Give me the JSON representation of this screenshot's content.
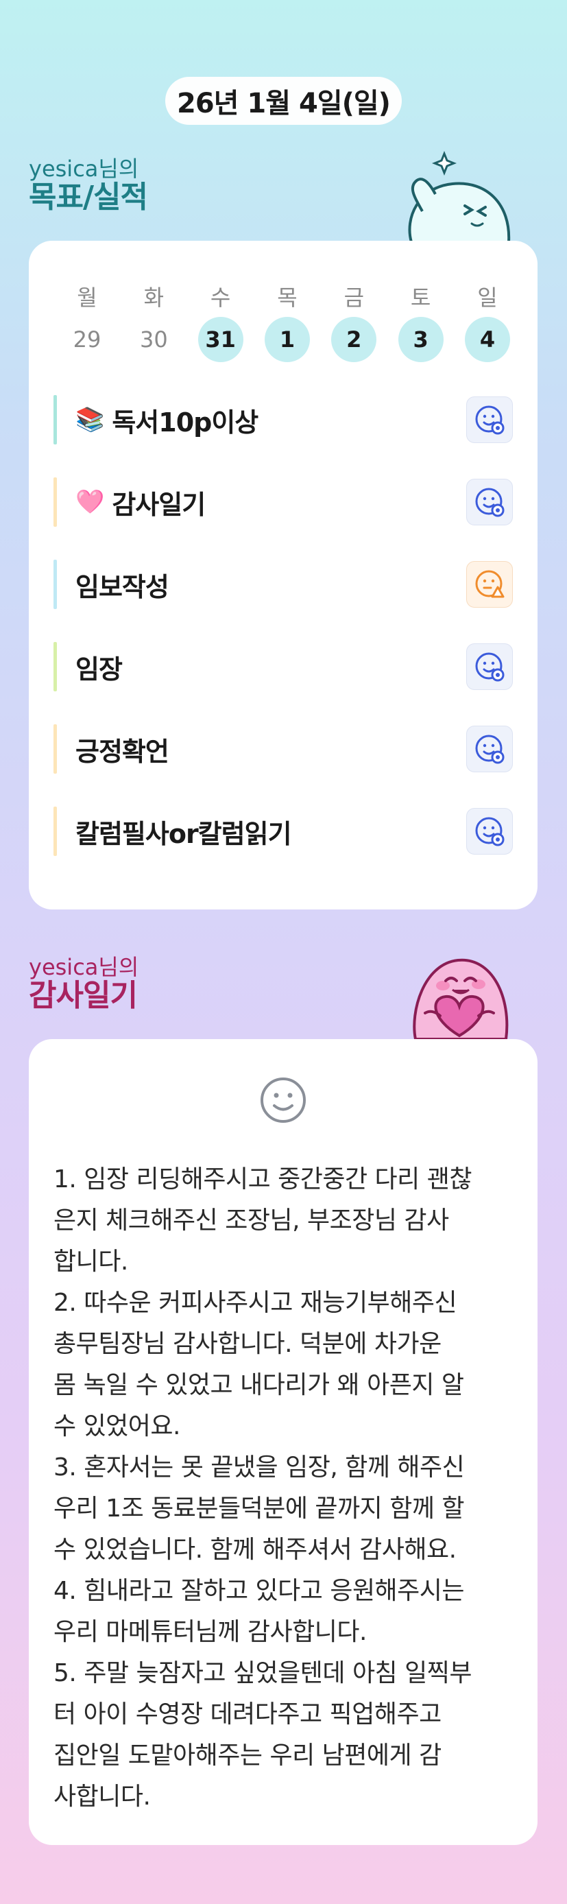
{
  "header": {
    "date": "26년 1월 4일(일)"
  },
  "goals_section": {
    "user": "yesica님의",
    "title": "목표/실적",
    "weekdays": [
      "월",
      "화",
      "수",
      "목",
      "금",
      "토",
      "일"
    ],
    "days": [
      {
        "num": "29",
        "active": false
      },
      {
        "num": "30",
        "active": false
      },
      {
        "num": "31",
        "active": true
      },
      {
        "num": "1",
        "active": true
      },
      {
        "num": "2",
        "active": true
      },
      {
        "num": "3",
        "active": true
      },
      {
        "num": "4",
        "active": true
      }
    ],
    "goals": [
      {
        "emoji": "📚",
        "label": "독서10p이상",
        "bar_color": "#a8e6dd",
        "status": "done",
        "status_icon": "smile-check-icon"
      },
      {
        "emoji": "🩷",
        "label": "감사일기",
        "bar_color": "#fde5b8",
        "status": "done",
        "status_icon": "smile-check-icon"
      },
      {
        "emoji": "",
        "label": "임보작성",
        "bar_color": "#bfe9f5",
        "status": "partial",
        "status_icon": "smile-warning-icon"
      },
      {
        "emoji": "",
        "label": "임장",
        "bar_color": "#d8f0a8",
        "status": "done",
        "status_icon": "smile-check-icon"
      },
      {
        "emoji": "",
        "label": "긍정확언",
        "bar_color": "#fde5b8",
        "status": "done",
        "status_icon": "smile-check-icon"
      },
      {
        "emoji": "",
        "label": "칼럼필사or칼럼읽기",
        "bar_color": "#fde5b8",
        "status": "done",
        "status_icon": "smile-check-icon"
      }
    ]
  },
  "thanks_section": {
    "user": "yesica님의",
    "title": "감사일기",
    "face_icon": "neutral-smile-icon",
    "text": "1. 임장 리딩해주시고 중간중간 다리 괜찮\n은지 체크해주신 조장님, 부조장님 감사\n합니다.\n2. 따수운 커피사주시고 재능기부해주신\n총무팀장님 감사합니다. 덕분에 차가운\n몸 녹일 수 있었고 내다리가 왜 아픈지 알\n수 있었어요.\n3. 혼자서는 못 끝냈을 임장, 함께 해주신\n우리 1조 동료분들덕분에 끝까지 함께 할\n수 있었습니다. 함께 해주셔서 감사해요.\n4. 힘내라고 잘하고 있다고 응원해주시는\n우리 마메튜터님께 감사합니다.\n5. 주말 늦잠자고 싶었을텐데 아침 일찍부\n터 아이 수영장 데려다주고 픽업해주고\n집안일 도맡아해주는 우리 남편에게 감\n사합니다."
  },
  "colors": {
    "accent_teal": "#1e7e86",
    "accent_pink": "#a8235f",
    "day_active": "#c4eef1",
    "status_done": "#3b5bdb",
    "status_partial": "#f08c2c"
  }
}
